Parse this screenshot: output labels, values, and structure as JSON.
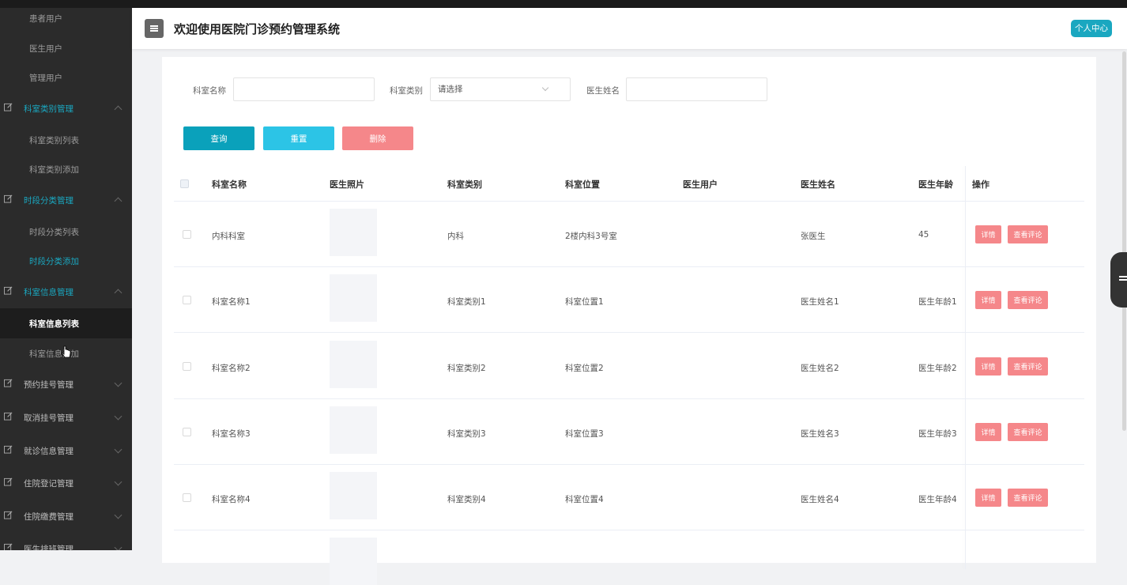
{
  "header": {
    "title": "欢迎使用医院门诊预约管理系统",
    "user_center": "个人中心"
  },
  "sidebar": {
    "items": [
      {
        "label": "患者用户",
        "type": "sub"
      },
      {
        "label": "医生用户",
        "type": "sub"
      },
      {
        "label": "管理用户",
        "type": "sub"
      },
      {
        "label": "科室类别管理",
        "type": "group"
      },
      {
        "label": "科室类别列表",
        "type": "sub"
      },
      {
        "label": "科室类别添加",
        "type": "sub"
      },
      {
        "label": "时段分类管理",
        "type": "group"
      },
      {
        "label": "时段分类列表",
        "type": "sub"
      },
      {
        "label": "时段分类添加",
        "type": "sub"
      },
      {
        "label": "科室信息管理",
        "type": "group"
      },
      {
        "label": "科室信息列表",
        "type": "sub"
      },
      {
        "label": "科室信息添加",
        "type": "sub"
      },
      {
        "label": "预约挂号管理",
        "type": "group"
      },
      {
        "label": "取消挂号管理",
        "type": "group"
      },
      {
        "label": "就诊信息管理",
        "type": "group"
      },
      {
        "label": "住院登记管理",
        "type": "group"
      },
      {
        "label": "住院缴费管理",
        "type": "group"
      },
      {
        "label": "医生排班管理",
        "type": "group"
      }
    ]
  },
  "search": {
    "dept_name_label": "科室名称",
    "dept_name_value": "",
    "dept_type_label": "科室类别",
    "dept_type_placeholder": "请选择",
    "doctor_name_label": "医生姓名",
    "doctor_name_value": ""
  },
  "buttons": {
    "query": "查询",
    "reset": "重置",
    "delete": "删除"
  },
  "table": {
    "columns": [
      "科室名称",
      "医生照片",
      "科室类别",
      "科室位置",
      "医生用户",
      "医生姓名",
      "医生年龄",
      "操作"
    ],
    "rows": [
      {
        "name": "内科科室",
        "type": "内科",
        "location": "2楼内科3号室",
        "user": "",
        "doctor": "张医生",
        "age": "45"
      },
      {
        "name": "科室名称1",
        "type": "科室类别1",
        "location": "科室位置1",
        "user": "",
        "doctor": "医生姓名1",
        "age": "医生年龄1"
      },
      {
        "name": "科室名称2",
        "type": "科室类别2",
        "location": "科室位置2",
        "user": "",
        "doctor": "医生姓名2",
        "age": "医生年龄2"
      },
      {
        "name": "科室名称3",
        "type": "科室类别3",
        "location": "科室位置3",
        "user": "",
        "doctor": "医生姓名3",
        "age": "医生年龄3"
      },
      {
        "name": "科室名称4",
        "type": "科室类别4",
        "location": "科室位置4",
        "user": "",
        "doctor": "医生姓名4",
        "age": "医生年龄4"
      }
    ],
    "actions": {
      "detail": "详情",
      "view_comments": "查看评论"
    }
  },
  "colors": {
    "accent": "#1aa7c0",
    "query": "#0aa1bb",
    "reset": "#2cc4e6",
    "danger": "#f5878a",
    "sidebar_bg": "#2b2b2b"
  }
}
